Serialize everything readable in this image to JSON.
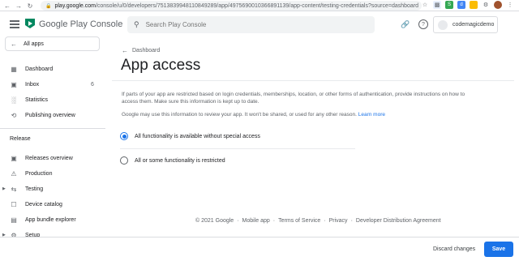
{
  "browser": {
    "url_domain": "play.google.com",
    "url_path": "/console/u/0/developers/7513839948110849289/app/4975690010366891139/app-content/testing-credentials?source=dashboard"
  },
  "header": {
    "brand": "Google Play Console",
    "search_placeholder": "Search Play Console",
    "account_name": "codemagicdemo"
  },
  "sidebar": {
    "all_apps": "All apps",
    "items": [
      {
        "label": "Dashboard",
        "icon": "dashboard-icon"
      },
      {
        "label": "Inbox",
        "icon": "inbox-icon",
        "count": "6"
      },
      {
        "label": "Statistics",
        "icon": "statistics-icon"
      },
      {
        "label": "Publishing overview",
        "icon": "publishing-icon"
      }
    ],
    "section_release": "Release",
    "release_items": [
      {
        "label": "Releases overview",
        "icon": "releases-icon"
      },
      {
        "label": "Production",
        "icon": "production-icon"
      },
      {
        "label": "Testing",
        "icon": "testing-icon"
      },
      {
        "label": "Device catalog",
        "icon": "device-icon"
      },
      {
        "label": "App bundle explorer",
        "icon": "bundle-icon"
      },
      {
        "label": "Setup",
        "icon": "setup-icon"
      }
    ]
  },
  "main": {
    "back_label": "Dashboard",
    "title": "App access",
    "description": "If parts of your app are restricted based on login credentials, memberships, location, or other forms of authentication, provide instructions on how to access them. Make sure this information is kept up to date.",
    "note": "Google may use this information to review your app. It won't be shared, or used for any other reason.",
    "learn_more": "Learn more",
    "options": [
      {
        "label": "All functionality is available without special access",
        "selected": true
      },
      {
        "label": "All or some functionality is restricted",
        "selected": false
      }
    ]
  },
  "footer": {
    "copyright": "© 2021 Google",
    "links": [
      "Mobile app",
      "Terms of Service",
      "Privacy",
      "Developer Distribution Agreement"
    ]
  },
  "actions": {
    "discard": "Discard changes",
    "save": "Save"
  },
  "colors": {
    "accent": "#1a73e8",
    "text": "#202124",
    "muted": "#5f6368"
  }
}
